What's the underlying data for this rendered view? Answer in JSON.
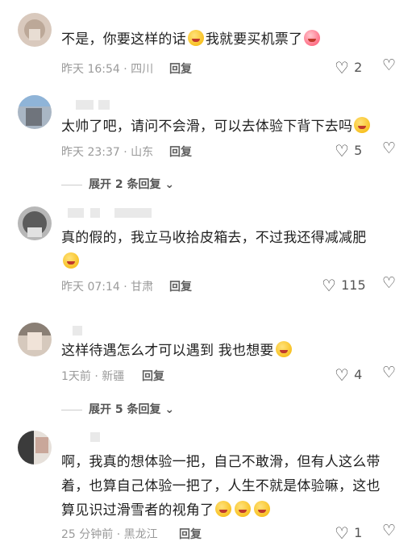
{
  "comments": [
    {
      "text": "不是，你要这样的话",
      "text_after": "我就要买机票了",
      "time": "昨天 16:54 · 四川",
      "reply": "回复",
      "likes": "2"
    },
    {
      "text": "太帅了吧，请问不会滑，可以去体验下背下去吗",
      "time": "昨天 23:37 · 山东",
      "reply": "回复",
      "likes": "5",
      "expand": "展开 2 条回复"
    },
    {
      "text": "真的假的，我立马收拾皮箱去，不过我还得减减肥",
      "time": "昨天 07:14 · 甘肃",
      "reply": "回复",
      "likes": "115"
    },
    {
      "text": "这样待遇怎么才可以遇到 我也想要",
      "time": "1天前 · 新疆",
      "reply": "回复",
      "likes": "4",
      "expand": "展开 5 条回复"
    },
    {
      "line1": "啊，我真的想体验一把，自己不敢滑，但有人这么带",
      "line2": "着，也算自己体验一把了，人生不就是体验嘛，这也",
      "line3": "算见识过滑雪者的视角了",
      "time": "25 分钟前 · 黑龙江",
      "reply": "回复",
      "likes": "1"
    }
  ],
  "icons": {
    "like": "heart-outline-icon",
    "dislike": "broken-heart-icon",
    "expand": "chevron-down-icon"
  }
}
